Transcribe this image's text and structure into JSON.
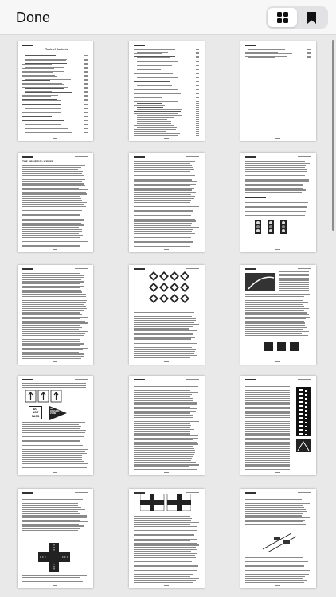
{
  "toolbar": {
    "done_label": "Done",
    "grid_icon": "grid-icon",
    "bookmark_icon": "bookmark-icon"
  },
  "colors": {
    "toolbar_bg": "#f7f7f7",
    "background": "#e9e9ea",
    "page_bg": "#ffffff"
  },
  "pages": [
    {
      "title": "Table of Contents"
    },
    {
      "title": ""
    },
    {
      "title": ""
    },
    {
      "title": "THE DRIVER'S LICENSE"
    },
    {
      "title": ""
    },
    {
      "title": "RULES OF THE ROAD"
    },
    {
      "title": ""
    },
    {
      "title": ""
    },
    {
      "title": ""
    },
    {
      "title": ""
    },
    {
      "title": ""
    },
    {
      "title": ""
    },
    {
      "title": ""
    },
    {
      "title": ""
    },
    {
      "title": ""
    }
  ],
  "signs": {
    "do_not_pass": [
      "DO",
      "NOT",
      "PASS"
    ],
    "no_passing_zone": [
      "NO",
      "PASSING",
      "ZONE"
    ]
  }
}
